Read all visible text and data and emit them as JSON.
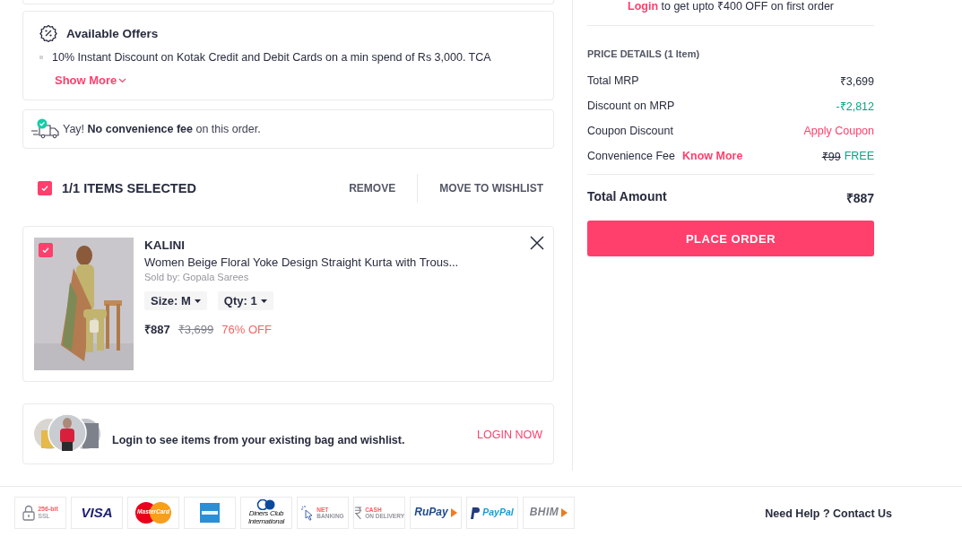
{
  "offers": {
    "title": "Available Offers",
    "items": [
      "10% Instant Discount on Kotak Credit and Debit Cards on a min spend of Rs 3,000. TCA"
    ],
    "show_more": "Show More"
  },
  "fee_note": "Yay! **No convenience fee** on this order.",
  "selection": {
    "checked": true,
    "label": "1/1 ITEMS SELECTED",
    "actions": [
      "REMOVE",
      "MOVE TO WISHLIST"
    ]
  },
  "item": {
    "checked": true,
    "brand": "KALINI",
    "title": "Women Beige Floral Yoke Design Straight Kurta with Trous...",
    "seller": "Sold by: Gopala Sarees",
    "size": "Size: M",
    "qty": "Qty: 1",
    "price": "₹887",
    "mrp": "₹3,699",
    "discount": "76% OFF"
  },
  "login_banner": {
    "text": "Login to see items from your existing bag and wishlist.",
    "action": "LOGIN NOW"
  },
  "login_offer": "**Login** to get upto ₹400 OFF on first order",
  "price_details": {
    "title": "PRICE DETAILS (1 Item)",
    "rows": [
      {
        "kind": "plain",
        "label": "Total MRP",
        "value": "₹3,699"
      },
      {
        "kind": "discount",
        "label": "Discount on MRP",
        "value": "-₹2,812"
      },
      {
        "kind": "link",
        "label": "Coupon Discount",
        "value": "Apply Coupon"
      },
      {
        "kind": "discount",
        "label": "Convenience Fee",
        "link": "Know More",
        "old_value": "₹99",
        "value": "FREE"
      }
    ],
    "total_label": "Total Amount",
    "total": "₹887",
    "button": "PLACE ORDER"
  },
  "payments": [
    {
      "kind": "ssl",
      "lines": [
        "256-bit",
        "SSL"
      ]
    },
    {
      "kind": "visa",
      "lines": [
        "VISA"
      ]
    },
    {
      "kind": "mastercard",
      "lines": [
        "MasterCard"
      ]
    },
    {
      "kind": "amex"
    },
    {
      "kind": "diners",
      "lines": [
        "Diners Club",
        "International"
      ]
    },
    {
      "kind": "netbanking",
      "lines": [
        "NET",
        "BANKING"
      ]
    },
    {
      "kind": "cod",
      "lines": [
        "CASH",
        "ON DELIVERY"
      ]
    },
    {
      "kind": "rupay",
      "lines": [
        "RuPay"
      ]
    },
    {
      "kind": "paypal",
      "lines": [
        "PayPal"
      ]
    },
    {
      "kind": "bhim",
      "lines": [
        "BHIM"
      ]
    }
  ],
  "help": "Need Help ? Contact Us"
}
